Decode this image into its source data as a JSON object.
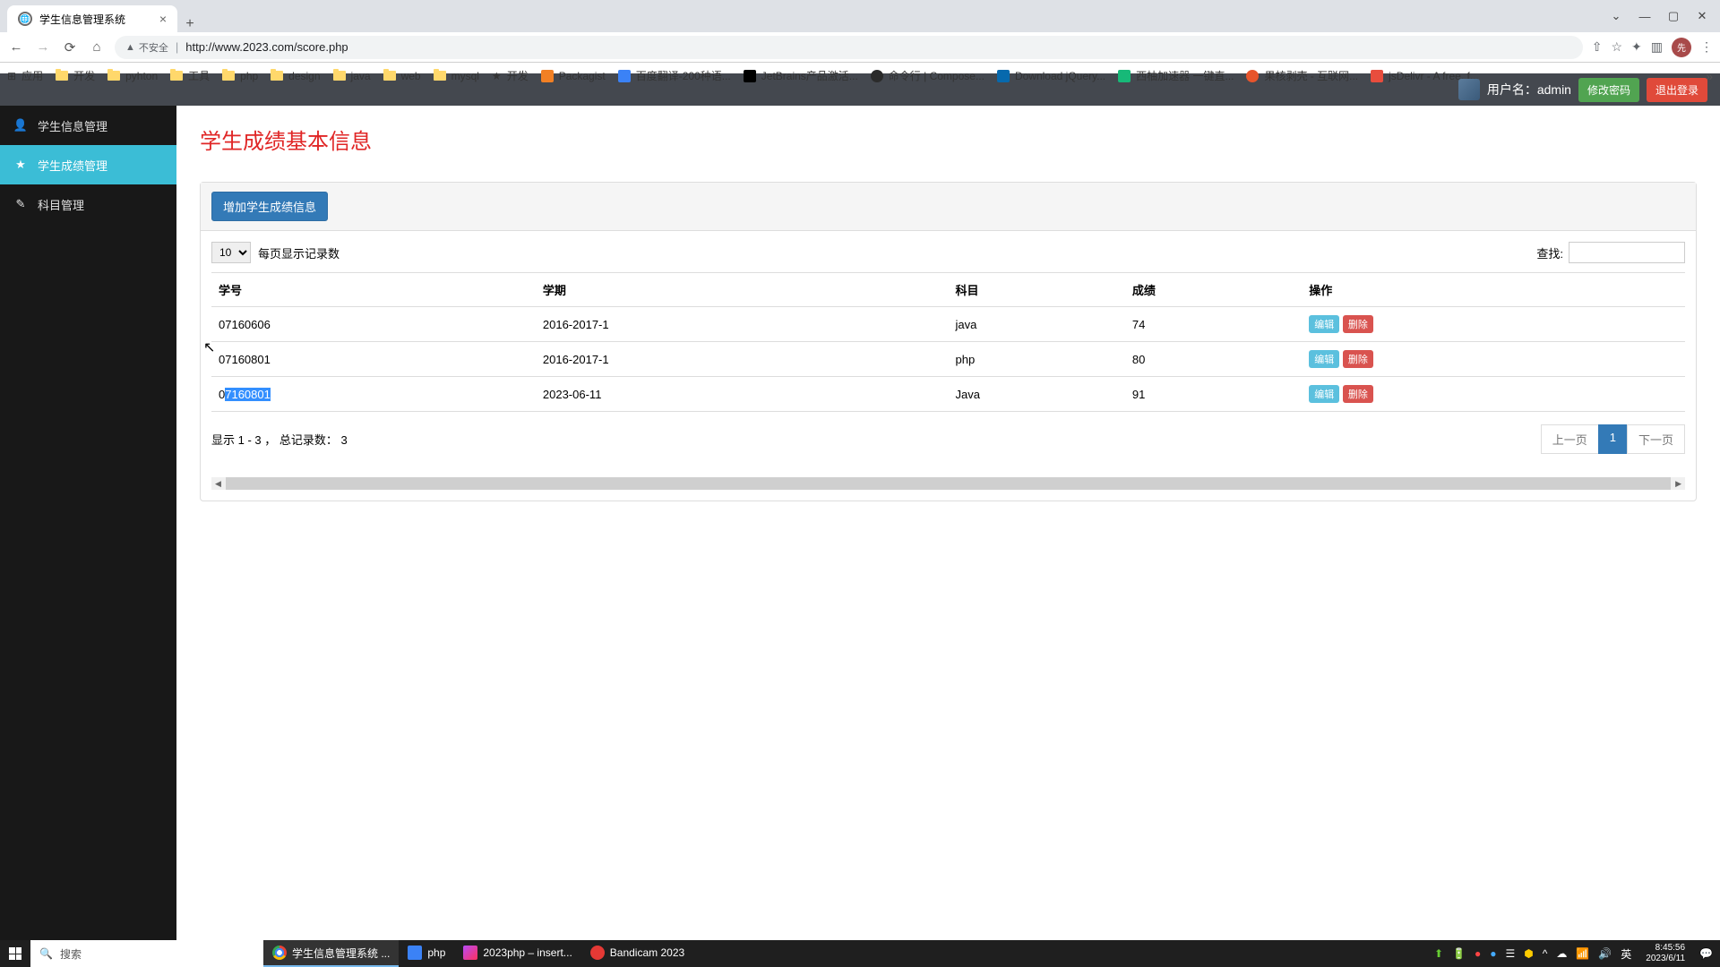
{
  "browser": {
    "tab_title": "学生信息管理系统",
    "url_warning": "不安全",
    "url": "http://www.2023.com/score.php",
    "bookmarks": [
      "应用",
      "开发",
      "pyhton",
      "工具",
      "php",
      "design",
      "java",
      "web",
      "mysql",
      "开发",
      "Packagist",
      "百度翻译-200种语...",
      "JetBrains产品激活...",
      "命令行 | Compose...",
      "Download jQuery...",
      "西柚加速器 一键直...",
      "果核剥壳 - 互联网...",
      "jsDelivr - A free, f..."
    ]
  },
  "header": {
    "user_label": "用户名：",
    "username": "admin",
    "change_pwd": "修改密码",
    "logout": "退出登录"
  },
  "sidebar": {
    "items": [
      {
        "label": "学生信息管理",
        "icon": "user"
      },
      {
        "label": "学生成绩管理",
        "icon": "star"
      },
      {
        "label": "科目管理",
        "icon": "pencil"
      }
    ]
  },
  "page": {
    "title": "学生成绩基本信息",
    "add_button": "增加学生成绩信息",
    "per_page_value": "10",
    "per_page_label": "每页显示记录数",
    "search_label": "查找:",
    "columns": [
      "学号",
      "学期",
      "科目",
      "成绩",
      "操作"
    ],
    "rows": [
      {
        "id": "07160606",
        "term": "2016-2017-1",
        "subject": "java",
        "score": "74"
      },
      {
        "id": "07160801",
        "term": "2016-2017-1",
        "subject": "php",
        "score": "80"
      },
      {
        "id": "07160801",
        "term": "2023-06-11",
        "subject": "Java",
        "score": "91"
      }
    ],
    "edit_label": "编辑",
    "delete_label": "删除",
    "footer_info": "显示 1 - 3 ， 总记录数： 3",
    "prev": "上一页",
    "page_num": "1",
    "next": "下一页"
  },
  "taskbar": {
    "search_placeholder": "搜索",
    "apps": [
      "学生信息管理系统 ...",
      "php",
      "2023php – insert...",
      "Bandicam 2023"
    ],
    "time": "8:45:56",
    "date": "2023/6/11"
  }
}
